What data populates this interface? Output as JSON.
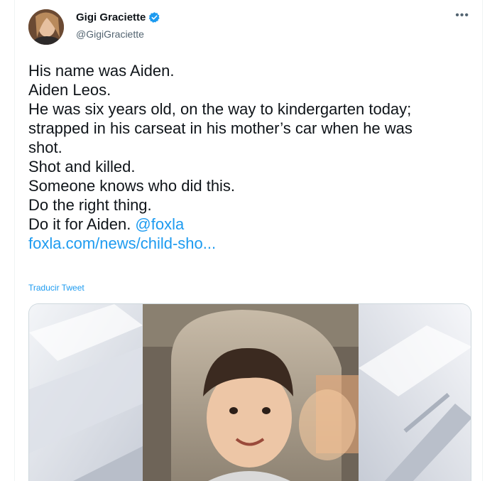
{
  "tweet": {
    "author": {
      "display_name": "Gigi Graciette",
      "handle": "@GigiGraciette",
      "verified": true
    },
    "more_icon": "more-horizontal-icon",
    "text_lines": [
      "His name was Aiden.",
      "Aiden Leos.",
      "He was six years old, on the way to kindergarten today;",
      "strapped in his carseat in his mother’s car when he was",
      "shot.",
      "Shot and killed.",
      "Someone knows who did this.",
      "Do the right thing."
    ],
    "last_line_text": "Do it for Aiden. ",
    "mention": "@foxla",
    "link_text": "foxla.com/news/child-sho...",
    "translate_label": "Traducir Tweet"
  },
  "colors": {
    "accent": "#1d9bf0",
    "text": "#0f1419",
    "secondary": "#536471"
  }
}
